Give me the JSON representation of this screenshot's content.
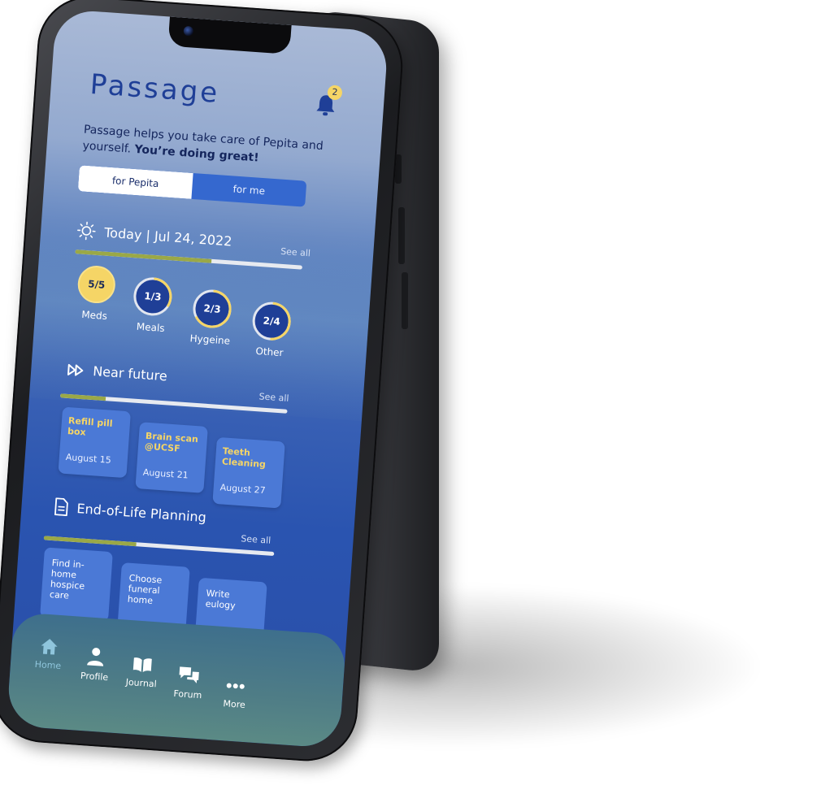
{
  "app": {
    "title": "Passage",
    "notifications_count": "2"
  },
  "tagline": {
    "text": "Passage helps you take care of Pepita and yourself. ",
    "emphasis": "You’re doing great!"
  },
  "toggle": {
    "options": [
      "for Pepita",
      "for me"
    ],
    "active": 0
  },
  "today": {
    "title": "Today | Jul 24, 2022",
    "see_all": "See all",
    "progress": 0.6,
    "rings": [
      {
        "value": "5/5",
        "label": "Meds",
        "fraction": 1.0
      },
      {
        "value": "1/3",
        "label": "Meals",
        "fraction": 0.333
      },
      {
        "value": "2/3",
        "label": "Hygeine",
        "fraction": 0.667
      },
      {
        "value": "2/4",
        "label": "Other",
        "fraction": 0.5
      }
    ]
  },
  "near_future": {
    "title": "Near future",
    "see_all": "See all",
    "progress": 0.2,
    "cards": [
      {
        "title": "Refill pill box",
        "date": "August 15"
      },
      {
        "title": "Brain scan @UCSF",
        "date": "August 21"
      },
      {
        "title": "Teeth Cleaning",
        "date": "August 27"
      }
    ]
  },
  "planning": {
    "title": "End-of-Life Planning",
    "see_all": "See all",
    "progress": 0.4,
    "tasks": [
      {
        "title": "Find in-home hospice care"
      },
      {
        "title": "Choose funeral home"
      },
      {
        "title": "Write eulogy"
      }
    ]
  },
  "nav": {
    "items": [
      {
        "label": "Home",
        "icon": "home-icon"
      },
      {
        "label": "Profile",
        "icon": "profile-icon"
      },
      {
        "label": "Journal",
        "icon": "journal-icon"
      },
      {
        "label": "Forum",
        "icon": "forum-icon"
      },
      {
        "label": "More",
        "icon": "more-icon"
      }
    ],
    "active": 0
  },
  "colors": {
    "brand": "#1f3f97",
    "accent_yellow": "#f5d566",
    "card_blue": "#4b79d6",
    "progress_green": "#9aa847"
  }
}
